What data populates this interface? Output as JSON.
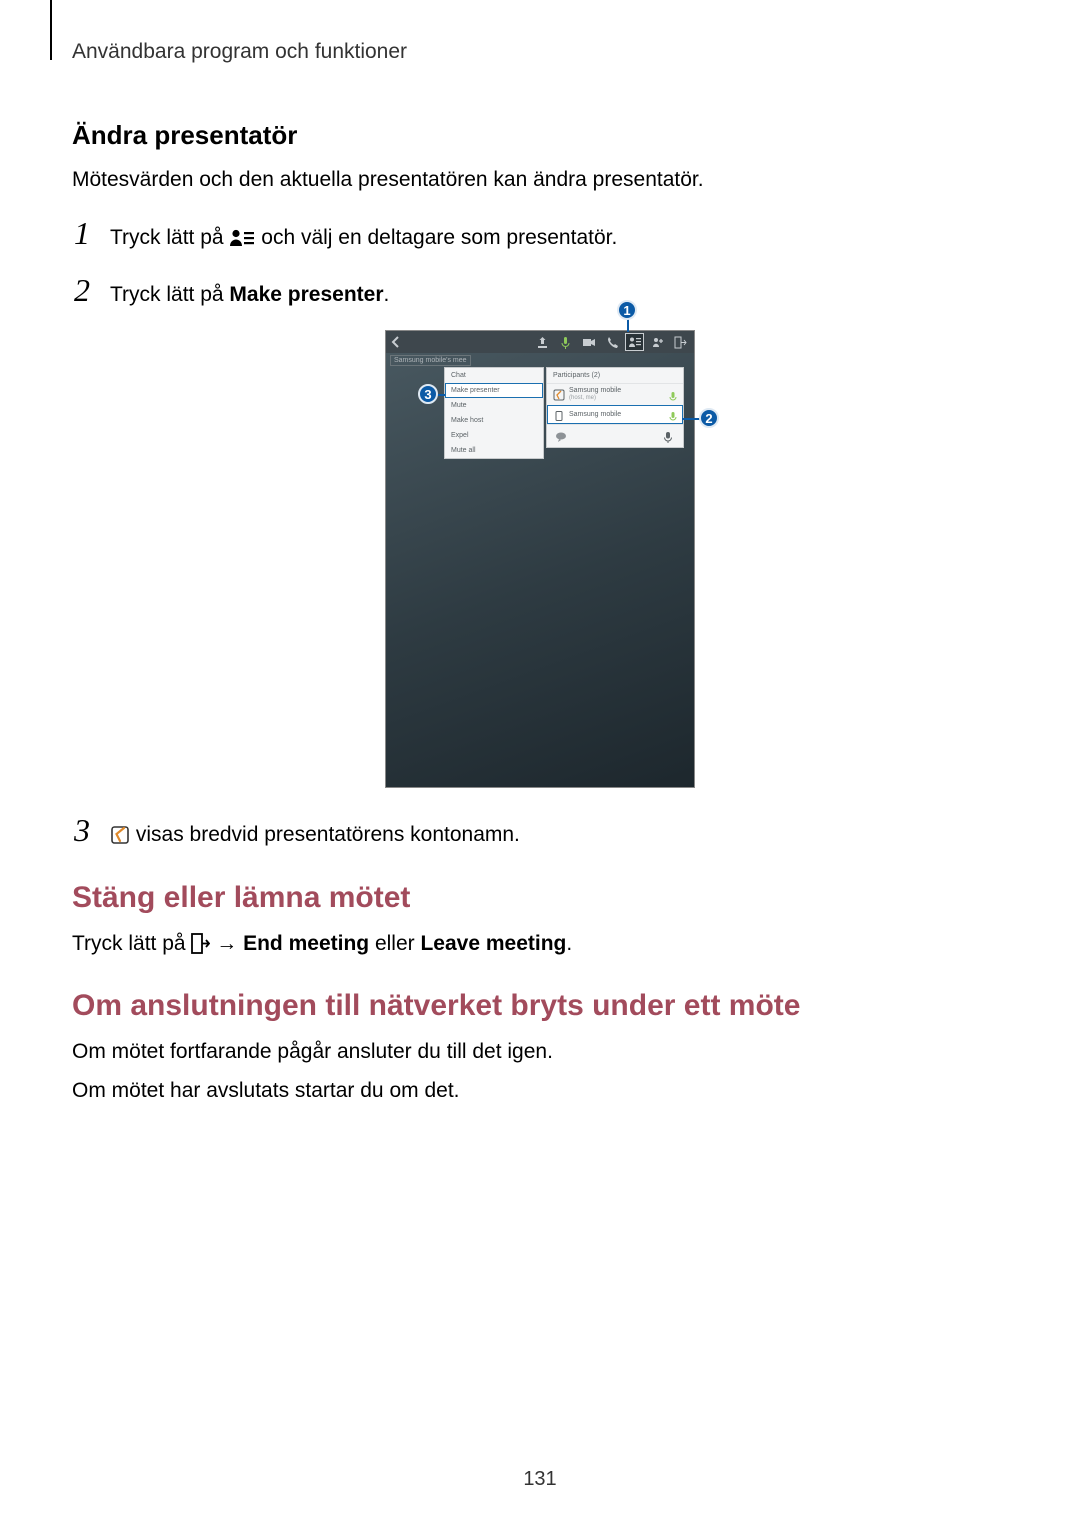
{
  "page": {
    "running_head": "Användbara program och funktioner",
    "page_number": "131"
  },
  "section_change_presenter": {
    "title": "Ändra presentatör",
    "intro": "Mötesvärden och den aktuella presentatören kan ändra presentatör.",
    "step1_num": "1",
    "step1_before": "Tryck lätt på ",
    "step1_after": " och välj en deltagare som presentatör.",
    "step2_num": "2",
    "step2_before": "Tryck lätt på ",
    "step2_bold": "Make presenter",
    "step2_after": ".",
    "step3_num": "3",
    "step3_text": " visas bredvid presentatörens kontonamn."
  },
  "screenshot": {
    "crumb": "Samsung mobile's mee",
    "menu_title": "Chat",
    "menu_items": [
      "Make presenter",
      "Mute",
      "Make host",
      "Expel",
      "Mute all"
    ],
    "panel_title": "Participants (2)",
    "participant1": "Samsung mobile",
    "participant1_sub": "(host, me)",
    "participant2": "Samsung mobile",
    "callout1": "1",
    "callout2": "2",
    "callout3": "3"
  },
  "section_close": {
    "title": "Stäng eller lämna mötet",
    "p_before": "Tryck lätt på ",
    "p_arrow": " → ",
    "p_bold1": "End meeting",
    "p_mid": " eller ",
    "p_bold2": "Leave meeting",
    "p_after": "."
  },
  "section_disconnect": {
    "title": "Om anslutningen till nätverket bryts under ett möte",
    "p1": "Om mötet fortfarande pågår ansluter du till det igen.",
    "p2": "Om mötet har avslutats startar du om det."
  }
}
